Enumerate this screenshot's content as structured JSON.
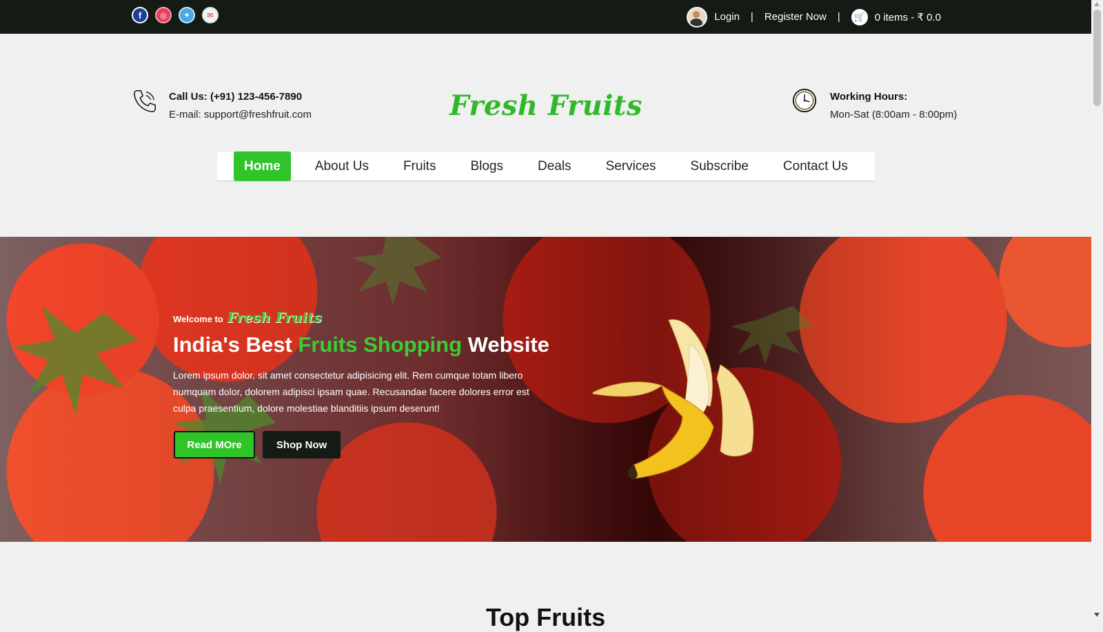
{
  "topbar": {
    "social": [
      {
        "name": "facebook-icon",
        "glyph": "f"
      },
      {
        "name": "instagram-icon",
        "glyph": "◎"
      },
      {
        "name": "twitter-icon",
        "glyph": "✦"
      },
      {
        "name": "gmail-icon",
        "glyph": "✉"
      }
    ],
    "login": "Login",
    "separator": "|",
    "register": "Register Now",
    "cart": "0 items - ₹ 0.0"
  },
  "header": {
    "call": "Call Us: (+91) 123-456-7890",
    "email": "E-mail: support@freshfruit.com",
    "brand": "Fresh Fruits",
    "hours_title": "Working Hours:",
    "hours": "Mon-Sat (8:00am - 8:00pm)"
  },
  "nav": {
    "items": [
      "Home",
      "About Us",
      "Fruits",
      "Blogs",
      "Deals",
      "Services",
      "Subscribe",
      "Contact Us"
    ],
    "active": "Home"
  },
  "hero": {
    "welcome": "Welcome to",
    "welcome_brand": "Fresh Fruits",
    "title_start": "India's Best ",
    "title_highlight": "Fruits Shopping",
    "title_end": " Website",
    "description": "Lorem ipsum dolor, sit amet consectetur adipisicing elit. Rem cumque totam libero numquam dolor, dolorem adipisci ipsam quae. Recusandae facere dolores error est culpa praesentium, dolore molestiae blanditiis ipsum deserunt!",
    "read_more": "Read MOre",
    "shop_now": "Shop Now"
  },
  "section": {
    "title": "Top Fruits"
  },
  "colors": {
    "accent": "#2fc42a",
    "topbar": "#141a14",
    "background": "#f0f0f0"
  }
}
